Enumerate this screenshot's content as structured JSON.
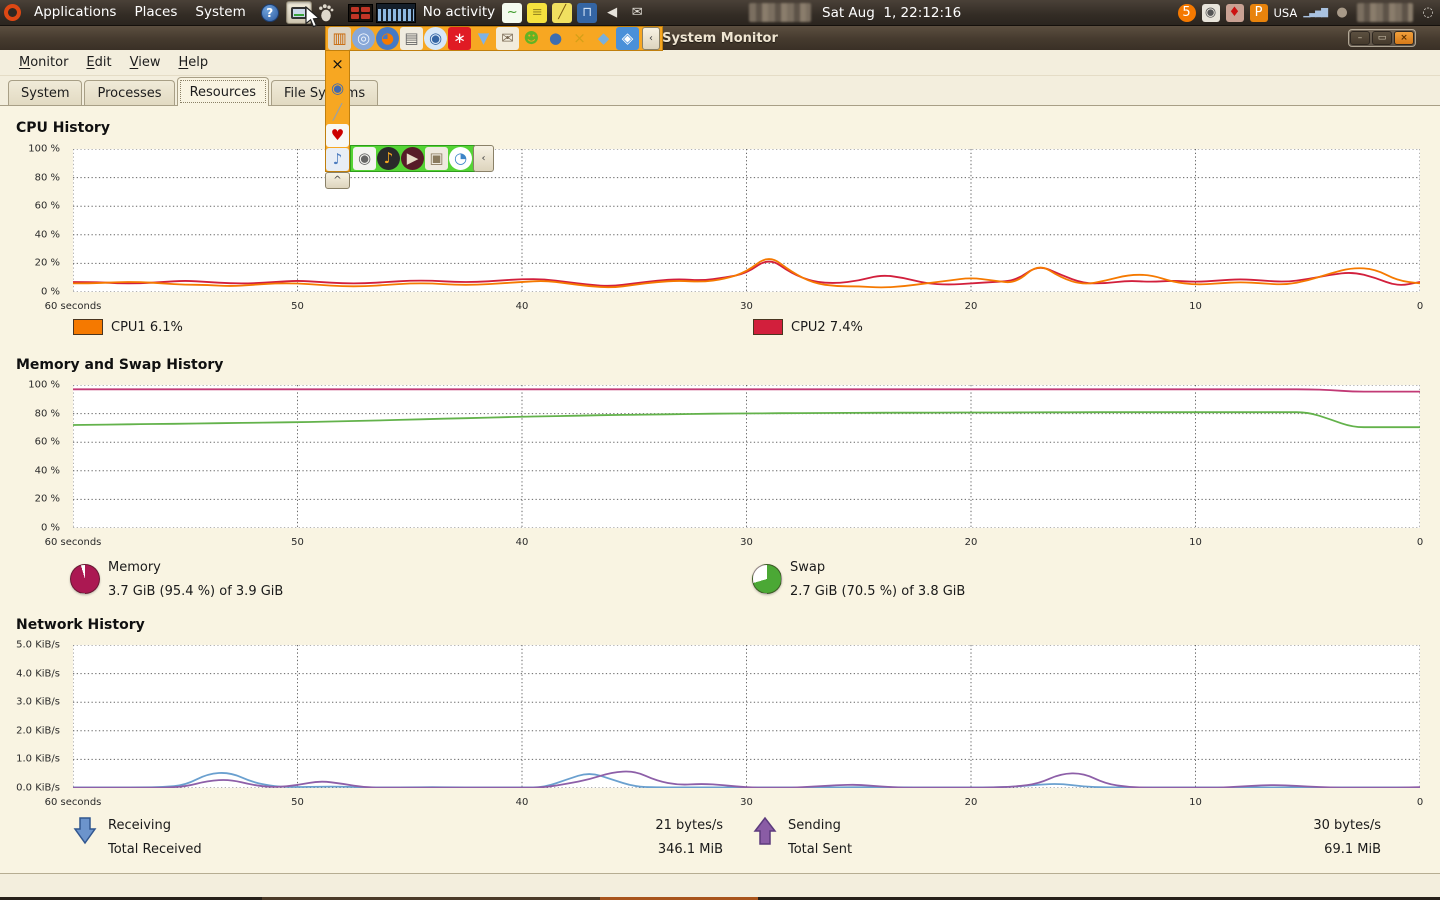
{
  "panel": {
    "menus": [
      "Applications",
      "Places",
      "System"
    ],
    "help_glyph": "?",
    "status_text": "No activity",
    "clock": "Sat Aug  1, 22:12:16",
    "tray_left": [
      {
        "name": "system-load-icon",
        "glyph": "~",
        "bg": "#f4fbef",
        "fg": "#3a9a28"
      },
      {
        "name": "sticky-note-icon",
        "glyph": "≡",
        "bg": "#f5e13e",
        "fg": "#9a8a20"
      },
      {
        "name": "edit-note-icon",
        "glyph": "╱",
        "bg": "#f0e060",
        "fg": "#7a5c10"
      },
      {
        "name": "lock-icon",
        "glyph": "⊓",
        "bg": "#3465a4",
        "fg": "#cfe0f5"
      },
      {
        "name": "volume-icon",
        "glyph": "◀",
        "bg": "transparent",
        "fg": "#e6e2da"
      },
      {
        "name": "mail-notify-icon",
        "glyph": "✉",
        "bg": "transparent",
        "fg": "#e6e2da"
      }
    ],
    "tray_right": [
      {
        "name": "badge-5-icon",
        "glyph": "5",
        "bg": "#f57900",
        "fg": "#fff",
        "round": true
      },
      {
        "name": "speaker-tray-icon",
        "glyph": "◉",
        "bg": "#e8e4da",
        "fg": "#555"
      },
      {
        "name": "flame-icon",
        "glyph": "♦",
        "bg": "#c9a193",
        "fg": "#cc1111"
      },
      {
        "name": "clipboard-icon",
        "glyph": "P",
        "bg": "#e8830c",
        "fg": "#fff"
      },
      {
        "type": "text",
        "name": "region-label",
        "label": "USA"
      },
      {
        "type": "bars",
        "name": "signal-bars-icon",
        "glyph": "▁▃▅▇"
      },
      {
        "name": "chat-bubble-icon",
        "glyph": "●",
        "bg": "transparent",
        "fg": "#a89a88"
      },
      {
        "type": "blur",
        "name": "censored-block",
        "width": 56
      },
      {
        "name": "power-icon",
        "glyph": "◌",
        "bg": "transparent",
        "fg": "#d8d4cc"
      }
    ]
  },
  "drawer": {
    "top_row": [
      {
        "name": "remote-desktop-icon",
        "glyph": "▥",
        "bg": "#ded6c6",
        "fg": "#c86400"
      },
      {
        "name": "chromium-icon",
        "glyph": "◎",
        "bg": "#89a8d8",
        "fg": "#eef4fc",
        "round": true
      },
      {
        "name": "firefox-icon",
        "glyph": "◕",
        "bg": "#4579c4",
        "fg": "#f57900",
        "round": true
      },
      {
        "name": "news-reader-icon",
        "glyph": "▤",
        "bg": "#f0ece0",
        "fg": "#666"
      },
      {
        "name": "globe-network-icon",
        "glyph": "◉",
        "bg": "#d8e8f8",
        "fg": "#3465a4",
        "round": true
      },
      {
        "name": "red-app-icon",
        "glyph": "∗",
        "bg": "#e01b24",
        "fg": "#fff"
      },
      {
        "name": "download-arrow-icon",
        "glyph": "▼",
        "bg": "transparent",
        "fg": "#7fb2e5"
      },
      {
        "name": "mail-app-icon",
        "glyph": "✉",
        "bg": "#f2ecdc",
        "fg": "#7a6a55"
      },
      {
        "name": "green-user-icon",
        "glyph": "☻",
        "bg": "transparent",
        "fg": "#63b324"
      },
      {
        "name": "pidgin-icon",
        "glyph": "●",
        "bg": "transparent",
        "fg": "#3d6db0"
      },
      {
        "name": "xchat-icon",
        "glyph": "×",
        "bg": "transparent",
        "fg": "#d4a017"
      },
      {
        "name": "dropbox-icon",
        "glyph": "◆",
        "bg": "transparent",
        "fg": "#7ab0dc"
      },
      {
        "name": "map-pin-icon",
        "glyph": "◈",
        "bg": "#4a90d9",
        "fg": "#fff"
      }
    ],
    "side_column": [
      {
        "name": "tools-icon",
        "glyph": "×",
        "bg": "transparent",
        "fg": "#111"
      },
      {
        "name": "science-icon",
        "glyph": "◉",
        "bg": "transparent",
        "fg": "#4169b0"
      },
      {
        "name": "trowel-icon",
        "glyph": "╱",
        "bg": "transparent",
        "fg": "#98a0a8"
      },
      {
        "name": "cards-icon",
        "glyph": "♥",
        "bg": "#f8f8f4",
        "fg": "#cc0000"
      },
      {
        "name": "media-film-icon",
        "glyph": "♪",
        "bg": "#e8eef6",
        "fg": "#4e7dbf"
      }
    ],
    "green_row": [
      {
        "name": "speaker-box-icon",
        "glyph": "◉",
        "bg": "#f4f4f0",
        "fg": "#666"
      },
      {
        "name": "vinyl-icon",
        "glyph": "♪",
        "bg": "#2a2a2a",
        "fg": "#f6a821",
        "round": true
      },
      {
        "name": "media-player-icon",
        "glyph": "▶",
        "bg": "#571c28",
        "fg": "#e8dcc8",
        "round": true
      },
      {
        "name": "photos-icon",
        "glyph": "▣",
        "bg": "#efeadf",
        "fg": "#8a7a5e"
      },
      {
        "name": "pinwheel-icon",
        "glyph": "◔",
        "bg": "#ffffff",
        "fg": "#3d85c8",
        "round": true
      }
    ],
    "collapse_glyph": "‹",
    "collapse_up_glyph": "^"
  },
  "window": {
    "title": "System Monitor",
    "menu_items": [
      "Monitor",
      "Edit",
      "View",
      "Help"
    ],
    "tabs": [
      "System",
      "Processes",
      "Resources",
      "File Systems"
    ],
    "active_tab": 2,
    "controls": {
      "minimize": "–",
      "maximize": "▭",
      "close": "×"
    }
  },
  "sections": {
    "cpu": {
      "title": "CPU History",
      "legend": [
        {
          "label": "CPU1 6.1%",
          "color": "#f57900"
        },
        {
          "label": "CPU2 7.4%",
          "color": "#d21f3c"
        }
      ]
    },
    "memory": {
      "title": "Memory and Swap History",
      "memory": {
        "label": "Memory",
        "value": "3.7 GiB (95.4 %) of 3.9 GiB",
        "pct": 95.4,
        "color": "#ab1852"
      },
      "swap": {
        "label": "Swap",
        "value": "2.7 GiB (70.5 %) of 3.8 GiB",
        "pct": 70.5,
        "color": "#4ba835"
      }
    },
    "network": {
      "title": "Network History",
      "receiving": {
        "label": "Receiving",
        "rate": "21 bytes/s",
        "total_label": "Total Received",
        "total": "346.1 MiB"
      },
      "sending": {
        "label": "Sending",
        "rate": "30 bytes/s",
        "total_label": "Total Sent",
        "total": "69.1 MiB"
      }
    }
  },
  "chart_data": [
    {
      "id": "cpu",
      "type": "line",
      "title": "CPU History",
      "x_ticks": [
        "60 seconds",
        "50",
        "40",
        "30",
        "20",
        "10",
        "0"
      ],
      "y_ticks": [
        "100 %",
        "80 %",
        "60 %",
        "40 %",
        "20 %",
        "0 %"
      ],
      "ylim": [
        0,
        100
      ],
      "grid": true,
      "legend_position": "below",
      "series": [
        {
          "name": "CPU2",
          "color": "#d21f3c",
          "values": [
            7,
            7,
            6,
            6,
            7,
            8,
            7,
            6,
            6,
            7,
            8,
            7,
            6,
            6,
            7,
            8,
            8,
            7,
            7,
            8,
            9,
            9,
            7,
            5,
            4,
            6,
            8,
            9,
            8,
            10,
            13,
            24,
            13,
            7,
            6,
            8,
            12,
            10,
            6,
            5,
            6,
            7,
            8,
            19,
            12,
            6,
            6,
            8,
            7,
            8,
            7,
            8,
            9,
            8,
            7,
            9,
            12,
            14,
            10,
            4,
            7
          ]
        },
        {
          "name": "CPU1",
          "color": "#f57900",
          "values": [
            6,
            6,
            7,
            7,
            6,
            5,
            5,
            4,
            5,
            6,
            6,
            5,
            4,
            4,
            5,
            6,
            6,
            5,
            5,
            6,
            7,
            8,
            6,
            4,
            3,
            5,
            7,
            8,
            7,
            9,
            14,
            26,
            14,
            6,
            4,
            4,
            3,
            4,
            6,
            8,
            10,
            8,
            6,
            20,
            10,
            5,
            8,
            12,
            12,
            7,
            5,
            6,
            7,
            6,
            5,
            8,
            13,
            17,
            16,
            8,
            6
          ]
        }
      ]
    },
    {
      "id": "memory-swap",
      "type": "line",
      "title": "Memory and Swap History",
      "x_ticks": [
        "60 seconds",
        "50",
        "40",
        "30",
        "20",
        "10",
        "0"
      ],
      "y_ticks": [
        "100 %",
        "80 %",
        "60 %",
        "40 %",
        "20 %",
        "0 %"
      ],
      "ylim": [
        0,
        100
      ],
      "grid": true,
      "legend_position": "below",
      "series": [
        {
          "name": "Swap",
          "color": "#63b24b",
          "values": [
            72,
            72.2,
            72.4,
            72.6,
            72.8,
            73,
            73.2,
            73.4,
            73.6,
            73.8,
            74,
            74.3,
            74.6,
            75,
            75.4,
            75.8,
            76.2,
            76.6,
            77,
            77.4,
            77.8,
            78.1,
            78.4,
            78.7,
            79,
            79.2,
            79.4,
            79.6,
            79.8,
            80,
            80.1,
            80.2,
            80.3,
            80.4,
            80.5,
            80.5,
            80.6,
            80.6,
            80.7,
            80.7,
            80.8,
            80.8,
            80.8,
            80.9,
            80.9,
            80.9,
            81,
            81,
            81,
            81,
            81,
            81,
            81,
            81,
            81,
            81,
            76,
            70.5,
            70.5,
            70.5,
            70.5
          ]
        },
        {
          "name": "Memory",
          "color": "#c23a76",
          "values": [
            97,
            97,
            97,
            97,
            97,
            97,
            97,
            97,
            97,
            97,
            97,
            97,
            97,
            97,
            97,
            97,
            97,
            97,
            97,
            97,
            97,
            97,
            97,
            97,
            97,
            97,
            97,
            97,
            97,
            97,
            97,
            97,
            97,
            97,
            97,
            97,
            97,
            97,
            97,
            97,
            97,
            97,
            97,
            97,
            97,
            97,
            97,
            97,
            97,
            97,
            97,
            97,
            97,
            97,
            97,
            97,
            96.5,
            95.4,
            95.4,
            95.4,
            95.4
          ]
        }
      ]
    },
    {
      "id": "network",
      "type": "line",
      "title": "Network History",
      "x_ticks": [
        "60 seconds",
        "50",
        "40",
        "30",
        "20",
        "10",
        "0"
      ],
      "y_ticks": [
        "5.0 KiB/s",
        "4.0 KiB/s",
        "3.0 KiB/s",
        "2.0 KiB/s",
        "1.0 KiB/s",
        "0.0 KiB/s"
      ],
      "ylim": [
        0,
        5
      ],
      "grid": true,
      "legend_position": "below",
      "series": [
        {
          "name": "Receiving",
          "color": "#6aa0cf",
          "values": [
            0.02,
            0.02,
            0.02,
            0.02,
            0.03,
            0.1,
            0.5,
            0.55,
            0.2,
            0.05,
            0.03,
            0.05,
            0.05,
            0.02,
            0.02,
            0.02,
            0.03,
            0.02,
            0.02,
            0.02,
            0.02,
            0.02,
            0.3,
            0.55,
            0.3,
            0.05,
            0.02,
            0.02,
            0.02,
            0.02,
            0.02,
            0.02,
            0.02,
            0.02,
            0.02,
            0.03,
            0.03,
            0.02,
            0.02,
            0.02,
            0.02,
            0.02,
            0.05,
            0.12,
            0.15,
            0.05,
            0.02,
            0.02,
            0.02,
            0.02,
            0.02,
            0.02,
            0.02,
            0.02,
            0.02,
            0.02,
            0.02,
            0.02,
            0.02,
            0.02,
            0.02
          ]
        },
        {
          "name": "Sending",
          "color": "#8d5fa8",
          "values": [
            0.01,
            0.01,
            0.01,
            0.01,
            0.01,
            0.05,
            0.25,
            0.3,
            0.1,
            0.02,
            0.1,
            0.25,
            0.15,
            0.02,
            0.01,
            0.01,
            0.01,
            0.01,
            0.01,
            0.01,
            0.01,
            0.02,
            0.15,
            0.3,
            0.55,
            0.6,
            0.25,
            0.1,
            0.15,
            0.1,
            0.02,
            0.01,
            0.01,
            0.05,
            0.1,
            0.12,
            0.05,
            0.01,
            0.01,
            0.01,
            0.01,
            0.02,
            0.05,
            0.15,
            0.5,
            0.52,
            0.15,
            0.03,
            0.01,
            0.01,
            0.01,
            0.01,
            0.05,
            0.1,
            0.1,
            0.05,
            0.02,
            0.01,
            0.01,
            0.01,
            0.03
          ]
        }
      ]
    }
  ]
}
